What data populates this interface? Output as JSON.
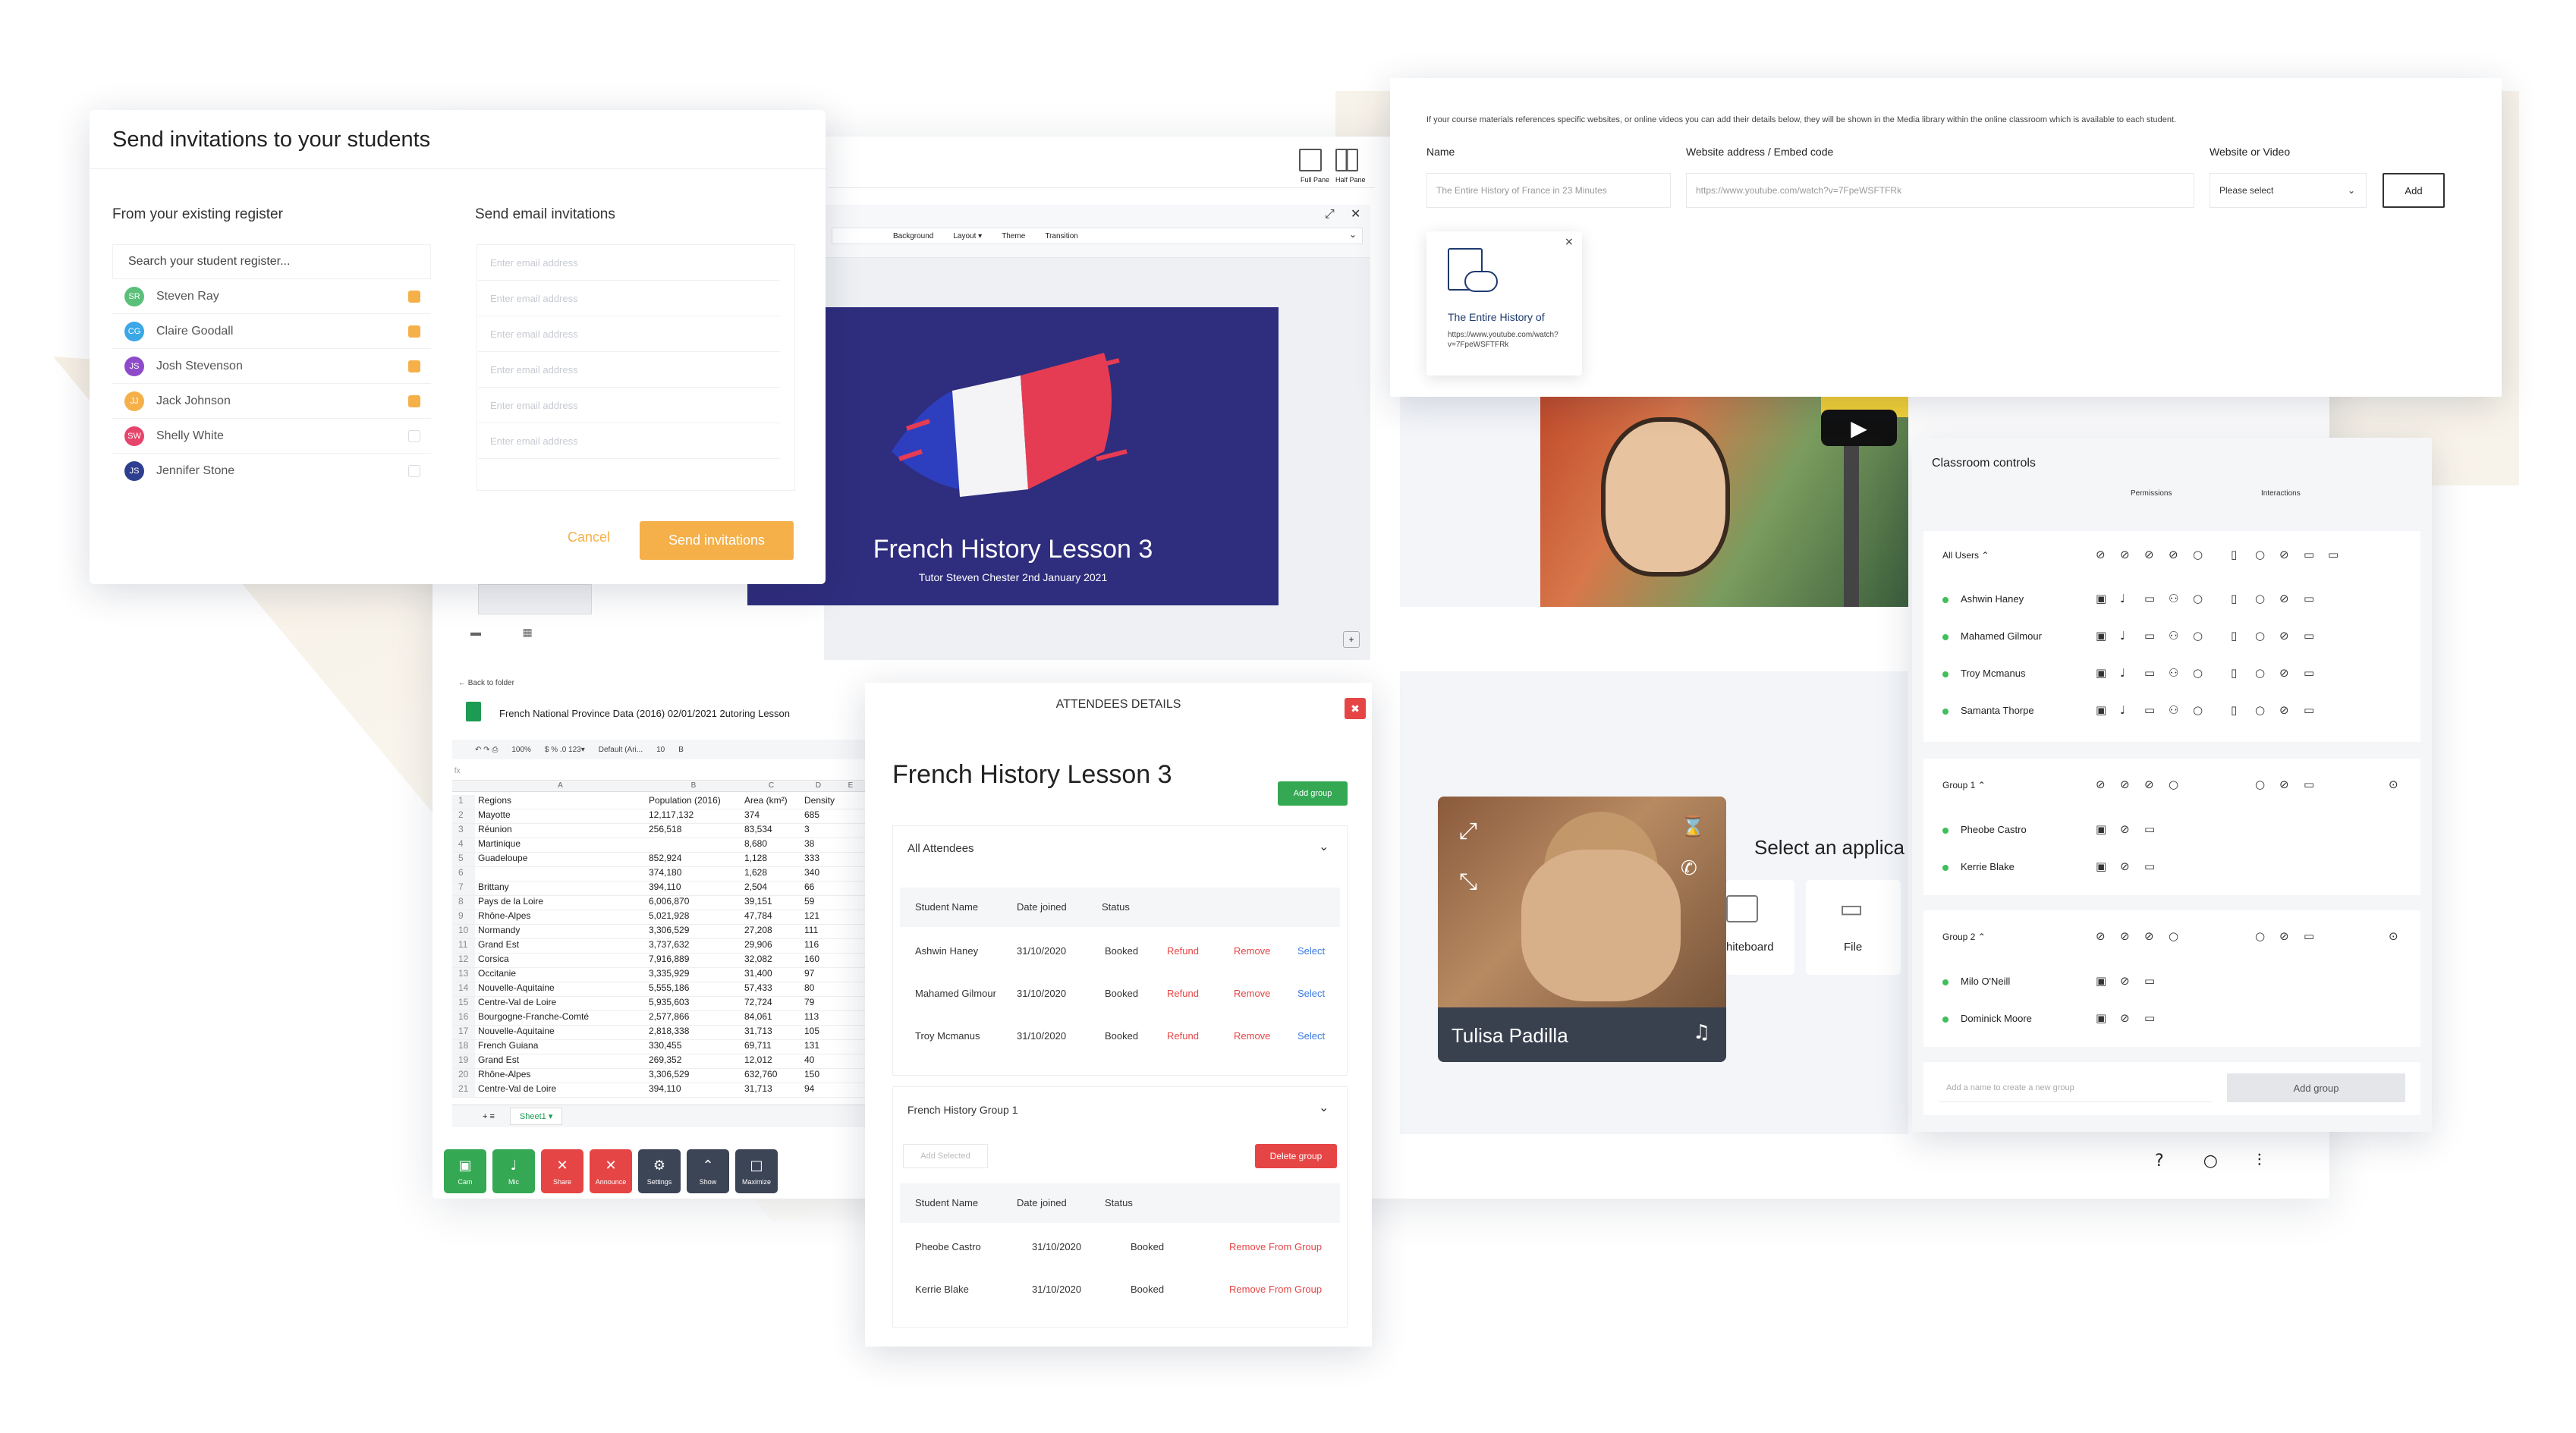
{
  "invite": {
    "title": "Send invitations to your students",
    "register_heading": "From your existing register",
    "email_heading": "Send email invitations",
    "search_placeholder": "Search your student register...",
    "students": [
      {
        "initials": "SR",
        "name": "Steven Ray",
        "checked": true,
        "color": "#5bbf7a"
      },
      {
        "initials": "CG",
        "name": "Claire Goodall",
        "checked": true,
        "color": "#3ba7e6"
      },
      {
        "initials": "JS",
        "name": "Josh Stevenson",
        "checked": true,
        "color": "#8e4bc9"
      },
      {
        "initials": "JJ",
        "name": "Jack Johnson",
        "checked": true,
        "color": "#f5b04a"
      },
      {
        "initials": "SW",
        "name": "Shelly White",
        "checked": false,
        "color": "#e6456b"
      },
      {
        "initials": "JS",
        "name": "Jennifer Stone",
        "checked": false,
        "color": "#2f3f8f"
      }
    ],
    "email_placeholder": "Enter email address",
    "cancel": "Cancel",
    "send": "Send invitations"
  },
  "media": {
    "info": "If your course materials references specific websites, or online videos you can add their details below, they will be shown in the Media library within the online classroom which is available to each student.",
    "name_label": "Name",
    "name_value": "The Entire History of France in 23 Minutes",
    "address_label": "Website address / Embed code",
    "address_value": "https://www.youtube.com/watch?v=7FpeWSFTFRk",
    "type_label": "Website or Video",
    "type_value": "Please select",
    "add": "Add",
    "card_title": "The Entire History of",
    "card_url": "https://www.youtube.com/watch?v=7FpeWSFTFRk",
    "card_close": "×"
  },
  "slides": {
    "full_pane": "Full Pane",
    "half_pane": "Half Pane",
    "toolbar": [
      "Background",
      "Layout ▾",
      "Theme",
      "Transition"
    ],
    "title": "French History Lesson 3",
    "subtitle": "Tutor Steven Chester 2nd January 2021"
  },
  "sheet": {
    "back": "Back to folder",
    "filename": "French National Province Data (2016) 02/01/2021 2utoring Lesson",
    "zoom": "100%",
    "font": "Default (Ari...",
    "font_size": "10",
    "columns": [
      "A",
      "B",
      "C",
      "D",
      "E"
    ],
    "rows": [
      [
        "1",
        "Regions",
        "Population (2016)",
        "Area (km²)",
        "Density"
      ],
      [
        "2",
        "Mayotte",
        "12,117,132",
        "374",
        "685"
      ],
      [
        "3",
        "Réunion",
        "256,518",
        "83,534",
        "3"
      ],
      [
        "4",
        "Martinique",
        "",
        "8,680",
        "38"
      ],
      [
        "5",
        "Guadeloupe",
        "852,924",
        "1,128",
        "333"
      ],
      [
        "6",
        "",
        "374,180",
        "1,628",
        "340"
      ],
      [
        "7",
        "Brittany",
        "394,110",
        "2,504",
        "66"
      ],
      [
        "8",
        "Pays de la Loire",
        "6,006,870",
        "39,151",
        "59"
      ],
      [
        "9",
        "Rhône-Alpes",
        "5,021,928",
        "47,784",
        "121"
      ],
      [
        "10",
        "Normandy",
        "3,306,529",
        "27,208",
        "111"
      ],
      [
        "11",
        "Grand Est",
        "3,737,632",
        "29,906",
        "116"
      ],
      [
        "12",
        "Corsica",
        "7,916,889",
        "32,082",
        "160"
      ],
      [
        "13",
        "Occitanie",
        "3,335,929",
        "31,400",
        "97"
      ],
      [
        "14",
        "Nouvelle-Aquitaine",
        "5,555,186",
        "57,433",
        "80"
      ],
      [
        "15",
        "Centre-Val de Loire",
        "5,935,603",
        "72,724",
        "79"
      ],
      [
        "16",
        "Bourgogne-Franche-Comté",
        "2,577,866",
        "84,061",
        "113"
      ],
      [
        "17",
        "Nouvelle-Aquitaine",
        "2,818,338",
        "31,713",
        "105"
      ],
      [
        "18",
        "French Guiana",
        "330,455",
        "69,711",
        "131"
      ],
      [
        "19",
        "Grand Est",
        "269,352",
        "12,012",
        "40"
      ],
      [
        "20",
        "Rhône-Alpes",
        "3,306,529",
        "632,760",
        "150"
      ],
      [
        "21",
        "Centre-Val de Loire",
        "394,110",
        "31,713",
        "94"
      ]
    ],
    "tab": "Sheet1"
  },
  "toolbar": [
    {
      "label": "Cam",
      "color": "#34a853",
      "icon": "▣"
    },
    {
      "label": "Mic",
      "color": "#34a853",
      "icon": "♩"
    },
    {
      "label": "Share",
      "color": "#e64545",
      "icon": "✕"
    },
    {
      "label": "Announce",
      "color": "#e64545",
      "icon": "✕"
    },
    {
      "label": "Settings",
      "color": "#3c4556",
      "icon": "⚙"
    },
    {
      "label": "Show",
      "color": "#3c4556",
      "icon": "⌃"
    },
    {
      "label": "Maximize",
      "color": "#3c4556",
      "icon": "□"
    }
  ],
  "attendees": {
    "header": "ATTENDEES DETAILS",
    "close": "✖",
    "title": "French History Lesson 3",
    "add_group": "Add group",
    "all_section": "All Attendees",
    "columns": [
      "Student Name",
      "Date joined",
      "Status"
    ],
    "all_rows": [
      {
        "name": "Ashwin Haney",
        "date": "31/10/2020",
        "status": "Booked",
        "refund": "Refund",
        "remove": "Remove",
        "select": "Select"
      },
      {
        "name": "Mahamed Gilmour",
        "date": "31/10/2020",
        "status": "Booked",
        "refund": "Refund",
        "remove": "Remove",
        "select": "Select"
      },
      {
        "name": "Troy Mcmanus",
        "date": "31/10/2020",
        "status": "Booked",
        "refund": "Refund",
        "remove": "Remove",
        "select": "Select"
      }
    ],
    "group_section": "French History Group 1",
    "add_selected": "Add Selected",
    "delete_group": "Delete group",
    "group_rows": [
      {
        "name": "Pheobe Castro",
        "date": "31/10/2020",
        "status": "Booked",
        "action": "Remove From Group"
      },
      {
        "name": "Kerrie Blake",
        "date": "31/10/2020",
        "status": "Booked",
        "action": "Remove From Group"
      }
    ]
  },
  "video": {
    "name": "Tulisa Padilla",
    "select_app": "Select an applica",
    "apps": [
      "hiteboard",
      "File"
    ]
  },
  "controls": {
    "title": "Classroom controls",
    "permissions": "Permissions",
    "interactions": "Interactions",
    "all_users": "All Users",
    "users": [
      "Ashwin Haney",
      "Mahamed Gilmour",
      "Troy Mcmanus",
      "Samanta Thorpe"
    ],
    "group1": "Group 1",
    "group1_users": [
      "Pheobe Castro",
      "Kerrie Blake"
    ],
    "group2": "Group 2",
    "group2_users": [
      "Milo O'Neill",
      "Dominick Moore"
    ],
    "new_group_placeholder": "Add a name to create a new group",
    "add_group": "Add group"
  },
  "colors": {
    "orange": "#f5b04a",
    "green": "#34a853",
    "red": "#e64545",
    "blue": "#3b7ae0",
    "slide_bg": "#2f2d7e"
  }
}
